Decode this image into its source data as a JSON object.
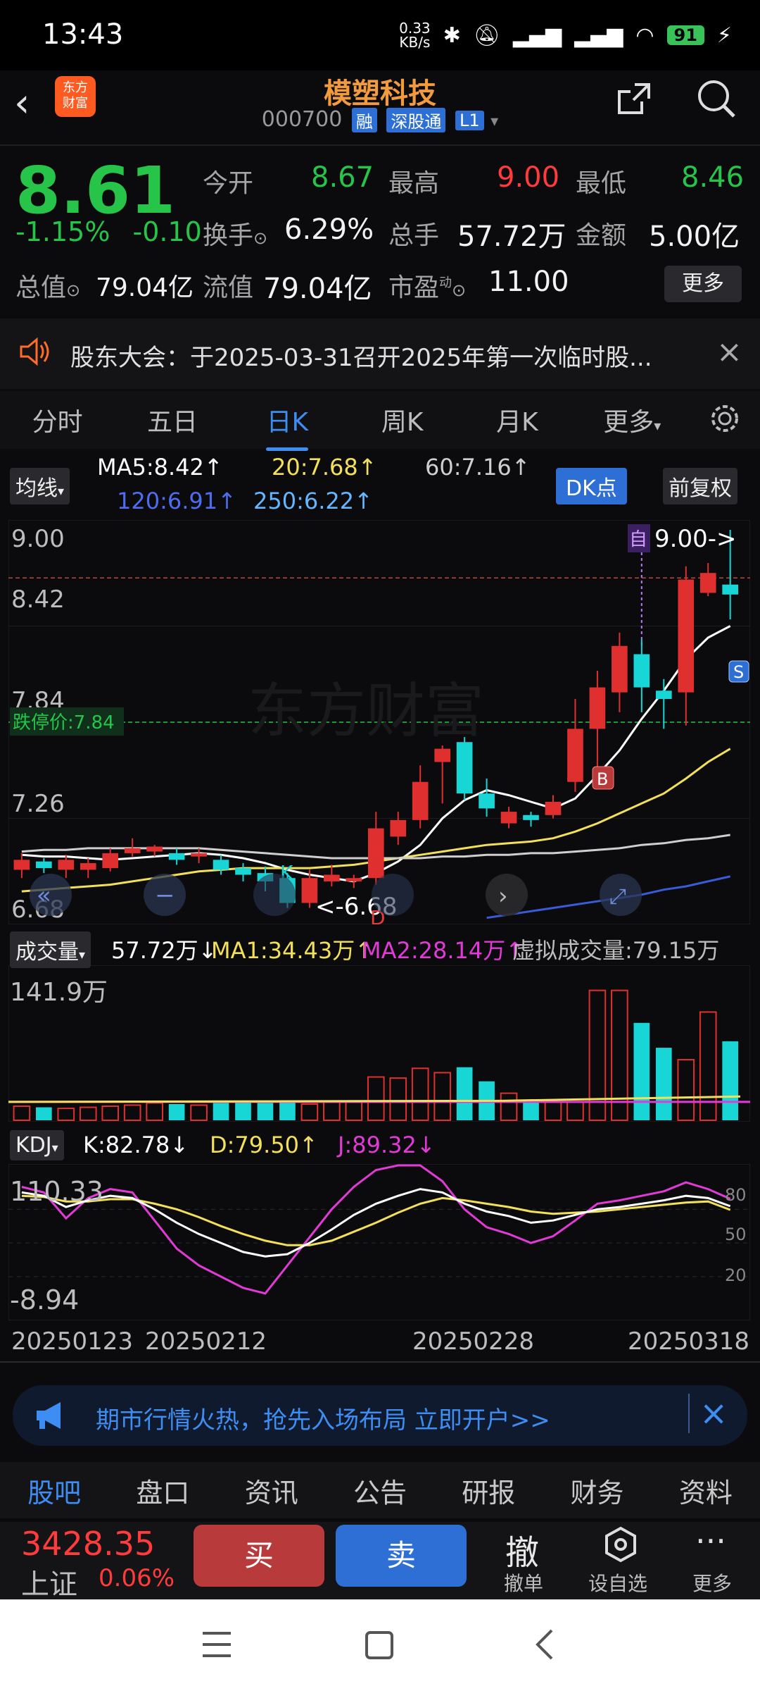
{
  "status": {
    "time": "13:43",
    "net": "0.33\nKB/s",
    "battery": "91"
  },
  "header": {
    "logo": "东方\n财富",
    "title": "模塑科技",
    "code": "000700",
    "tags": [
      "融",
      "深股通",
      "L1"
    ]
  },
  "quote": {
    "price": "8.61",
    "change_pct": "-1.15%",
    "change": "-0.10",
    "open_label": "今开",
    "open": "8.67",
    "high_label": "最高",
    "high": "9.00",
    "low_label": "最低",
    "low": "8.46",
    "turnover_label": "换手",
    "turnover": "6.29%",
    "vol_label": "总手",
    "vol": "57.72万",
    "amount_label": "金额",
    "amount": "5.00亿",
    "mktcap_label": "总值",
    "mktcap": "79.04亿",
    "float_label": "流值",
    "float": "79.04亿",
    "pe_label": "市盈",
    "pe_sup": "动",
    "pe": "11.00",
    "more": "更多"
  },
  "notice": {
    "text": "股东大会：于2025-03-31召开2025年第一次临时股..."
  },
  "tabs": [
    "分时",
    "五日",
    "日K",
    "周K",
    "月K",
    "更多"
  ],
  "ma": {
    "btn": "均线",
    "ma5": "MA5:8.42↑",
    "ma20": "20:7.68↑",
    "ma60": "60:7.16↑",
    "ma120": "120:6.91↑",
    "ma250": "250:6.22↑",
    "dk": "DK点",
    "fq": "前复权"
  },
  "kchart": {
    "y_top": "9.00",
    "y2": "8.42",
    "y3": "7.84",
    "y4": "7.26",
    "y_bot": "6.68",
    "limit_label": "跌停价:7.84",
    "max_label": "9.00->",
    "min_label": "<-6.68",
    "self_mark": "自",
    "b_mark": "B",
    "s_mark": "S",
    "k_mark": "K",
    "d_mark": "D"
  },
  "chart_data": {
    "type": "candlestick",
    "ylim": [
      6.68,
      9.0
    ],
    "candles": [
      {
        "o": 6.95,
        "c": 7.01,
        "h": 7.05,
        "l": 6.9
      },
      {
        "o": 7.0,
        "c": 6.96,
        "h": 7.02,
        "l": 6.93
      },
      {
        "o": 6.95,
        "c": 7.01,
        "h": 7.04,
        "l": 6.9
      },
      {
        "o": 6.95,
        "c": 6.99,
        "h": 7.02,
        "l": 6.9
      },
      {
        "o": 6.96,
        "c": 7.05,
        "h": 7.08,
        "l": 6.94
      },
      {
        "o": 7.05,
        "c": 7.08,
        "h": 7.14,
        "l": 7.03
      },
      {
        "o": 7.06,
        "c": 7.09,
        "h": 7.1,
        "l": 7.03
      },
      {
        "o": 7.05,
        "c": 7.01,
        "h": 7.08,
        "l": 6.98
      },
      {
        "o": 7.03,
        "c": 7.05,
        "h": 7.08,
        "l": 6.99
      },
      {
        "o": 7.01,
        "c": 6.95,
        "h": 7.04,
        "l": 6.92
      },
      {
        "o": 6.96,
        "c": 6.92,
        "h": 6.99,
        "l": 6.88
      },
      {
        "o": 6.93,
        "c": 6.88,
        "h": 6.97,
        "l": 6.82
      },
      {
        "o": 6.9,
        "c": 6.75,
        "h": 6.93,
        "l": 6.72
      },
      {
        "o": 6.75,
        "c": 6.9,
        "h": 6.95,
        "l": 6.72
      },
      {
        "o": 6.88,
        "c": 6.92,
        "h": 6.98,
        "l": 6.85
      },
      {
        "o": 6.88,
        "c": 6.9,
        "h": 6.92,
        "l": 6.84
      },
      {
        "o": 6.9,
        "c": 7.2,
        "h": 7.3,
        "l": 6.86
      },
      {
        "o": 7.15,
        "c": 7.25,
        "h": 7.3,
        "l": 7.1
      },
      {
        "o": 7.25,
        "c": 7.48,
        "h": 7.58,
        "l": 7.2
      },
      {
        "o": 7.6,
        "c": 7.68,
        "h": 7.7,
        "l": 7.35
      },
      {
        "o": 7.72,
        "c": 7.41,
        "h": 7.75,
        "l": 7.37
      },
      {
        "o": 7.41,
        "c": 7.32,
        "h": 7.5,
        "l": 7.27
      },
      {
        "o": 7.23,
        "c": 7.3,
        "h": 7.33,
        "l": 7.2
      },
      {
        "o": 7.28,
        "c": 7.25,
        "h": 7.3,
        "l": 7.21
      },
      {
        "o": 7.28,
        "c": 7.36,
        "h": 7.4,
        "l": 7.26
      },
      {
        "o": 7.48,
        "c": 7.8,
        "h": 7.98,
        "l": 7.42
      },
      {
        "o": 7.8,
        "c": 8.05,
        "h": 8.15,
        "l": 7.48
      },
      {
        "o": 8.02,
        "c": 8.3,
        "h": 8.38,
        "l": 7.9
      },
      {
        "o": 8.25,
        "c": 8.05,
        "h": 8.34,
        "l": 7.9
      },
      {
        "o": 8.03,
        "c": 7.98,
        "h": 8.1,
        "l": 7.8
      },
      {
        "o": 8.02,
        "c": 8.7,
        "h": 8.78,
        "l": 7.82
      },
      {
        "o": 8.62,
        "c": 8.74,
        "h": 8.8,
        "l": 8.6
      },
      {
        "o": 8.67,
        "c": 8.61,
        "h": 9.0,
        "l": 8.46
      }
    ],
    "ma_series": [
      {
        "name": "MA5",
        "color": "#ffffff",
        "values": [
          7.04,
          7.03,
          7.03,
          7.02,
          7.01,
          7.02,
          7.03,
          7.04,
          7.05,
          7.04,
          7.02,
          6.99,
          6.95,
          6.92,
          6.9,
          6.88,
          6.93,
          7.0,
          7.1,
          7.26,
          7.37,
          7.43,
          7.4,
          7.36,
          7.32,
          7.38,
          7.52,
          7.67,
          7.86,
          8.03,
          8.22,
          8.35,
          8.42
        ]
      },
      {
        "name": "20",
        "color": "#f3e05a",
        "values": [
          6.82,
          6.83,
          6.84,
          6.85,
          6.86,
          6.88,
          6.9,
          6.92,
          6.94,
          6.95,
          6.96,
          6.96,
          6.96,
          6.96,
          6.97,
          6.98,
          7.0,
          7.02,
          7.04,
          7.06,
          7.08,
          7.1,
          7.11,
          7.12,
          7.14,
          7.18,
          7.23,
          7.29,
          7.35,
          7.41,
          7.5,
          7.6,
          7.68
        ]
      },
      {
        "name": "60",
        "color": "#cfcfcf",
        "values": [
          7.06,
          7.07,
          7.07,
          7.08,
          7.08,
          7.08,
          7.08,
          7.08,
          7.08,
          7.07,
          7.06,
          7.05,
          7.04,
          7.03,
          7.02,
          7.02,
          7.02,
          7.02,
          7.02,
          7.03,
          7.03,
          7.04,
          7.04,
          7.05,
          7.05,
          7.06,
          7.07,
          7.08,
          7.1,
          7.11,
          7.13,
          7.14,
          7.16
        ]
      },
      {
        "name": "120",
        "color": "#3a5bd8",
        "values": [
          null,
          null,
          null,
          null,
          null,
          null,
          null,
          null,
          null,
          null,
          null,
          null,
          null,
          null,
          null,
          null,
          null,
          null,
          null,
          null,
          null,
          6.66,
          6.68,
          6.7,
          6.72,
          6.74,
          6.76,
          6.78,
          6.8,
          6.83,
          6.85,
          6.88,
          6.91
        ]
      }
    ],
    "volume": [
      13,
      12,
      11,
      12,
      13,
      14,
      16,
      15,
      14,
      16,
      17,
      16,
      17,
      15,
      17,
      17,
      40,
      39,
      48,
      44,
      49,
      36,
      25,
      18,
      17,
      17,
      120,
      120,
      90,
      67,
      56,
      100,
      73
    ],
    "volume_ylim": [
      0,
      141.9
    ],
    "volume_label": "141.9万",
    "kdj": {
      "ylim": [
        -8.94,
        110.33
      ],
      "y_ticks": [
        "110.33",
        "-8.94"
      ],
      "right_ticks": [
        "80",
        "50",
        "20"
      ],
      "K": [
        95,
        92,
        82,
        88,
        92,
        90,
        80,
        68,
        58,
        50,
        42,
        38,
        40,
        50,
        62,
        75,
        85,
        92,
        98,
        95,
        85,
        78,
        74,
        68,
        70,
        75,
        80,
        82,
        85,
        88,
        92,
        90,
        82.78
      ],
      "D": [
        92,
        91,
        87,
        87,
        89,
        89,
        85,
        80,
        73,
        65,
        58,
        52,
        48,
        48,
        52,
        60,
        68,
        77,
        85,
        90,
        88,
        85,
        82,
        78,
        76,
        77,
        78,
        80,
        82,
        84,
        86,
        87,
        79.5
      ],
      "J": [
        100,
        95,
        72,
        90,
        98,
        95,
        70,
        45,
        30,
        20,
        10,
        5,
        30,
        55,
        80,
        100,
        115,
        122,
        125,
        105,
        80,
        64,
        58,
        50,
        56,
        70,
        85,
        88,
        92,
        96,
        104,
        98,
        89.32
      ]
    },
    "x_ticks": [
      "20250123",
      "20250212",
      "20250228",
      "20250318"
    ]
  },
  "volbar": {
    "btn": "成交量",
    "v": "57.72万↓",
    "ma1": "MA1:34.43万↑",
    "ma2": "MA2:28.14万↑",
    "virtual": "虚拟成交量:79.15万"
  },
  "kdjbar": {
    "btn": "KDJ",
    "k": "K:82.78↓",
    "d": "D:79.50↑",
    "j": "J:89.32↓"
  },
  "ad": {
    "text": "期市行情火热，抢先入场布局 立即开户>>"
  },
  "btabs": [
    "股吧",
    "盘口",
    "资讯",
    "公告",
    "研报",
    "财务",
    "资料"
  ],
  "trade": {
    "index": "3428.35",
    "index_name": "上证",
    "index_chg": "0.06%",
    "buy": "买",
    "sell": "卖",
    "cancel_icon": "撤",
    "cancel": "撤单",
    "self": "设自选",
    "more": "更多"
  }
}
